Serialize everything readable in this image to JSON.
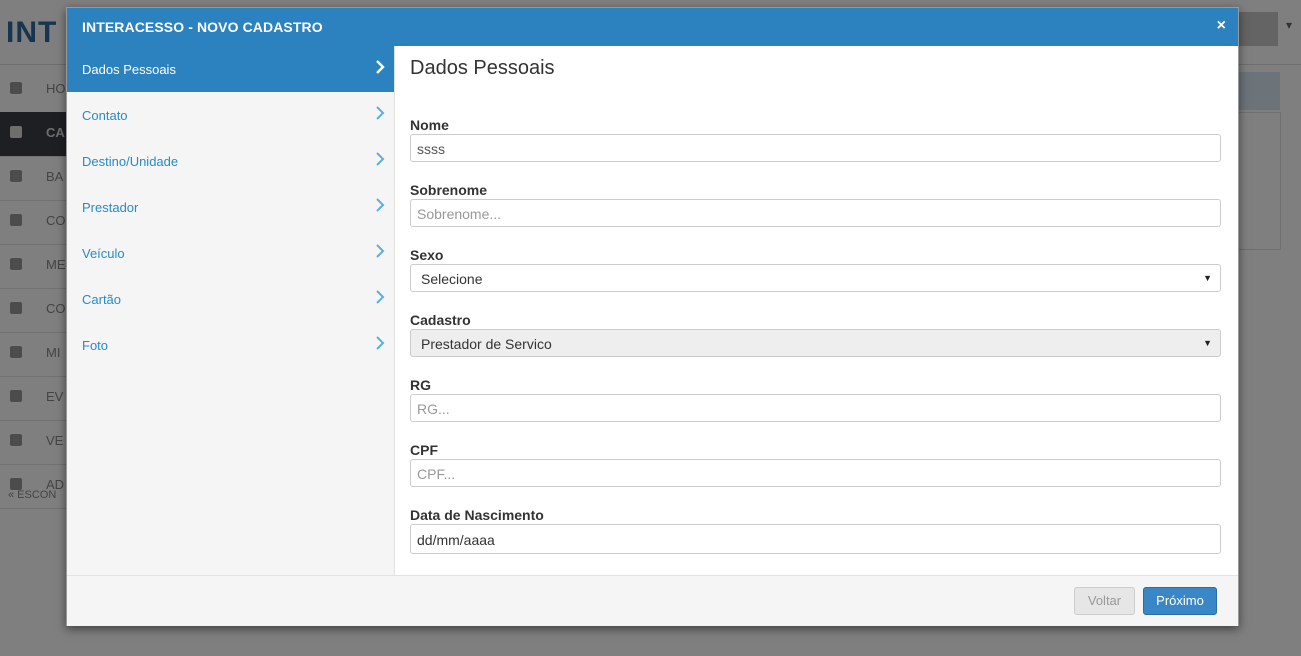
{
  "background": {
    "logo_text": "INT",
    "sidebar": [
      {
        "label": "HO",
        "active": false
      },
      {
        "label": "CA",
        "active": true
      },
      {
        "label": "BA",
        "active": false
      },
      {
        "label": "CO",
        "active": false
      },
      {
        "label": "ME",
        "active": false
      },
      {
        "label": "CO",
        "active": false
      },
      {
        "label": "MI",
        "active": false
      },
      {
        "label": "EV",
        "active": false
      },
      {
        "label": "VE",
        "active": false
      },
      {
        "label": "AD",
        "active": false
      }
    ],
    "hide_link": "« ESCON"
  },
  "modal": {
    "title": "INTERACESSO - NOVO CADASTRO",
    "close_glyph": "×",
    "nav": [
      {
        "label": "Dados Pessoais",
        "active": true
      },
      {
        "label": "Contato",
        "active": false
      },
      {
        "label": "Destino/Unidade",
        "active": false
      },
      {
        "label": "Prestador",
        "active": false
      },
      {
        "label": "Veículo",
        "active": false
      },
      {
        "label": "Cartão",
        "active": false
      },
      {
        "label": "Foto",
        "active": false
      }
    ],
    "section_title": "Dados Pessoais",
    "fields": {
      "nome": {
        "label": "Nome",
        "value": "ssss",
        "placeholder": ""
      },
      "sobrenome": {
        "label": "Sobrenome",
        "value": "",
        "placeholder": "Sobrenome..."
      },
      "sexo": {
        "label": "Sexo",
        "selected": "Selecione"
      },
      "cadastro": {
        "label": "Cadastro",
        "selected": "Prestador de Servico",
        "disabled": true
      },
      "rg": {
        "label": "RG",
        "value": "",
        "placeholder": "RG..."
      },
      "cpf": {
        "label": "CPF",
        "value": "",
        "placeholder": "CPF..."
      },
      "nascimento": {
        "label": "Data de Nascimento",
        "value": "dd/mm/aaaa"
      }
    },
    "footer": {
      "back_label": "Voltar",
      "next_label": "Próximo"
    },
    "colors": {
      "primary": "#2b82be",
      "link": "#2a8ac6",
      "nav_bg": "#f5f5f5"
    }
  }
}
